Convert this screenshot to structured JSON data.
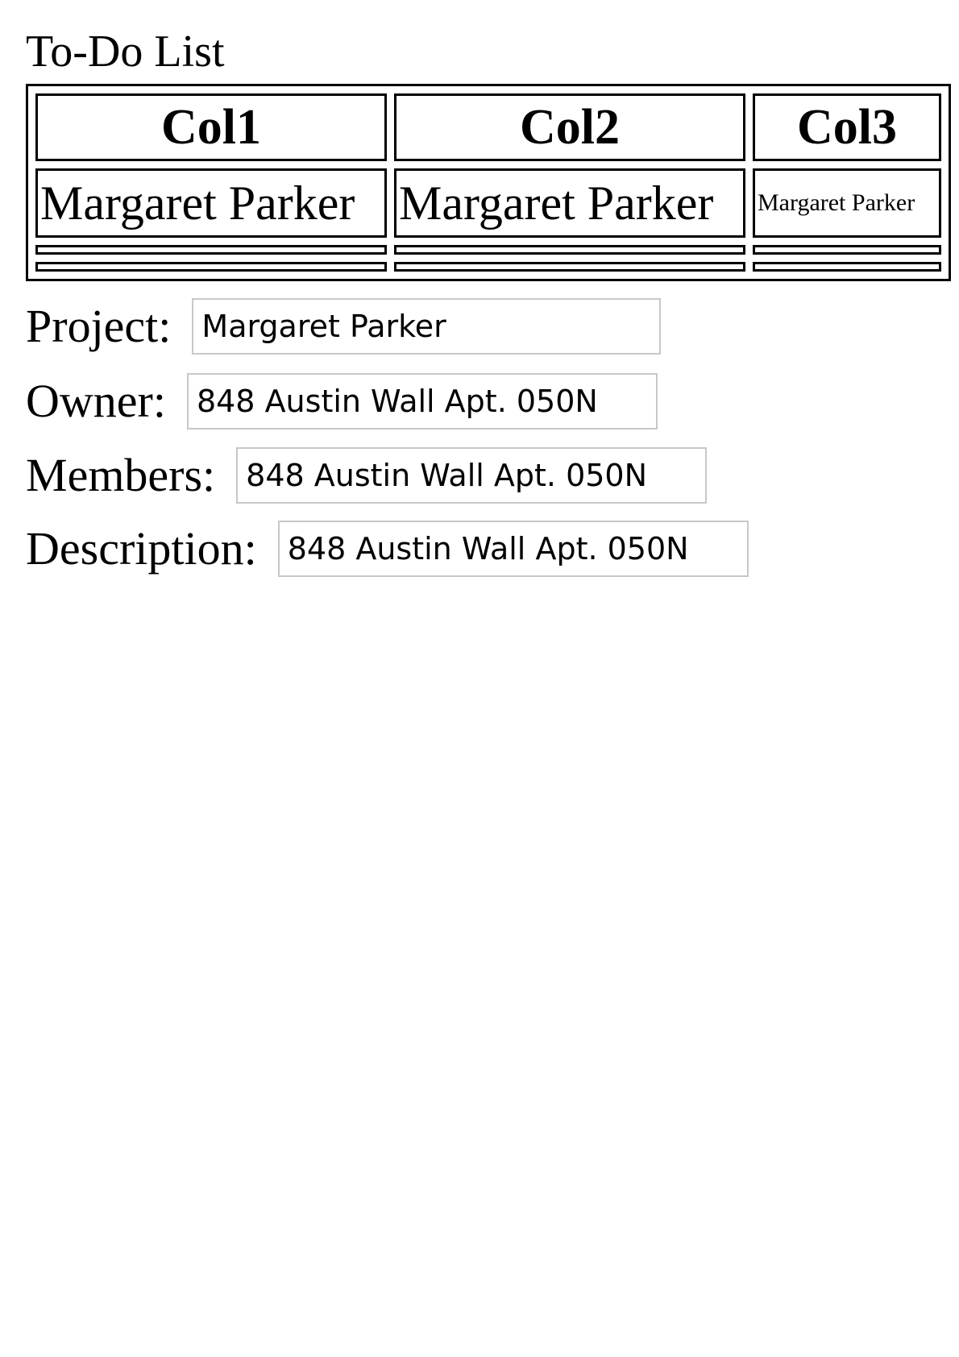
{
  "title": "To-Do List",
  "table": {
    "headers": [
      "Col1",
      "Col2",
      "Col3"
    ],
    "rows": [
      [
        "Margaret Parker",
        "Margaret Parker",
        "Margaret Parker"
      ]
    ]
  },
  "form": {
    "project": {
      "label": "Project:",
      "value": "Margaret Parker"
    },
    "owner": {
      "label": "Owner:",
      "value": "848 Austin Wall Apt. 050N"
    },
    "members": {
      "label": "Members:",
      "value": "848 Austin Wall Apt. 050N"
    },
    "description": {
      "label": "Description:",
      "value": "848 Austin Wall Apt. 050N"
    }
  }
}
